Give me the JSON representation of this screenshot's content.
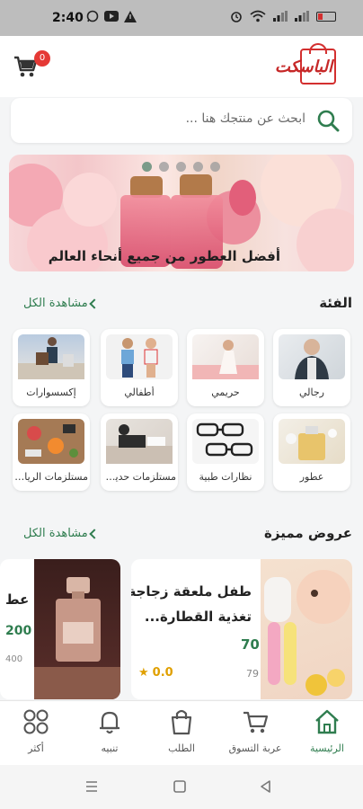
{
  "status_bar": {
    "time": "2:40"
  },
  "header": {
    "cart_count": "0",
    "logo_text": "الباسكت"
  },
  "search": {
    "placeholder": "ابحث عن منتجك هنا ..."
  },
  "banner": {
    "caption": "أفضل العطور من جميع أنحاء العالم",
    "slides": 5,
    "active_slide": 1
  },
  "categories": {
    "title": "الفئة",
    "see_all": "مشاهدة الكل",
    "items": [
      {
        "label": "رجالي"
      },
      {
        "label": "حريمي"
      },
      {
        "label": "أطفالي"
      },
      {
        "label": "إكسسوارات"
      },
      {
        "label": "عطور"
      },
      {
        "label": "نظارات طبية"
      },
      {
        "label": "مستلزمات حديقة..."
      },
      {
        "label": "مستلزمات الرياضة"
      }
    ]
  },
  "featured": {
    "title": "عروض مميزة",
    "see_all": "مشاهدة الكل",
    "products": [
      {
        "name": "طفل ملعقة زجاجة تغذية القطارة...",
        "price": "70",
        "old_price": "79",
        "rating": "0.0"
      },
      {
        "partial_name": "عط",
        "partial_price": "200",
        "partial_old": "400"
      }
    ]
  },
  "bottom_nav": {
    "items": [
      {
        "label": "الرئيسية",
        "icon": "home-icon"
      },
      {
        "label": "عربة التسوق",
        "icon": "cart-icon"
      },
      {
        "label": "الطلب",
        "icon": "bag-icon"
      },
      {
        "label": "تنبيه",
        "icon": "bell-icon"
      },
      {
        "label": "أكثر",
        "icon": "grid-icon"
      }
    ]
  },
  "colors": {
    "accent": "#2f7d4f",
    "badge": "#e53935",
    "rating": "#e0a000"
  }
}
